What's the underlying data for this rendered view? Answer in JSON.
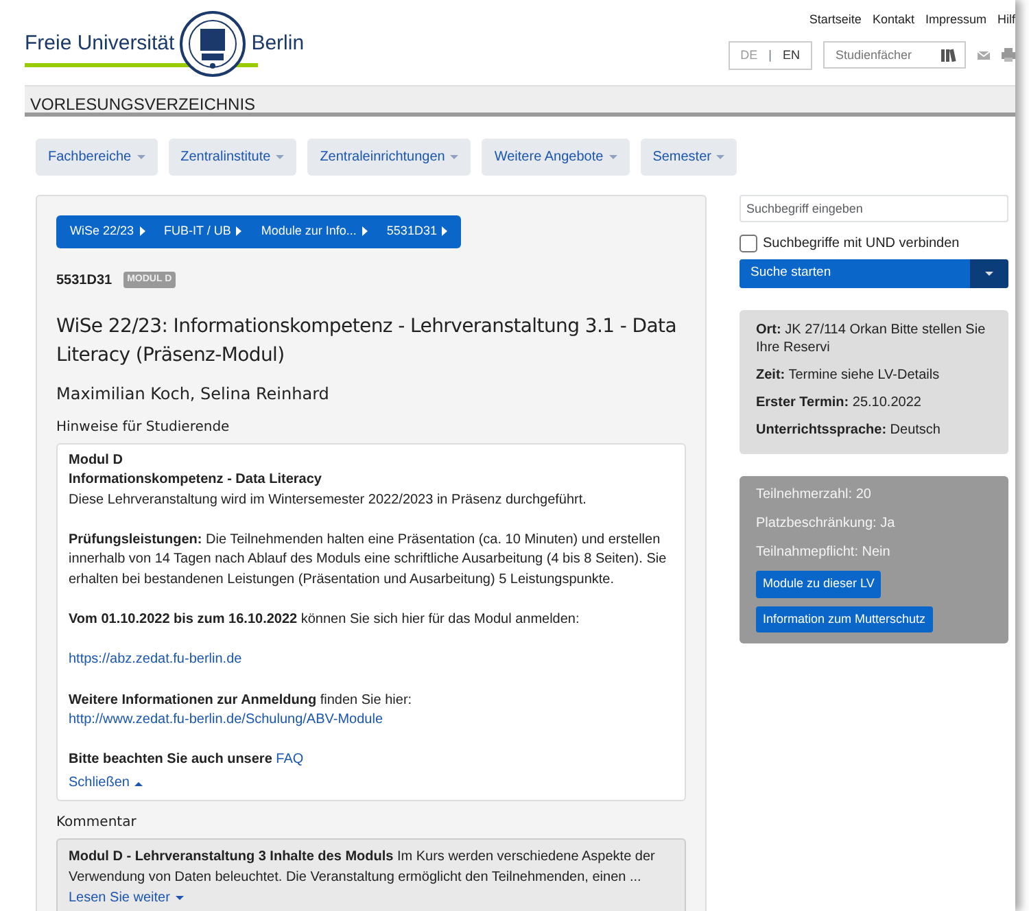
{
  "logo": {
    "left": "Freie Universität",
    "right": "Berlin"
  },
  "top_links": [
    "Startseite",
    "Kontakt",
    "Impressum",
    "Hilf"
  ],
  "language_separator": "|",
  "languages": [
    {
      "label": "DE",
      "selected": true
    },
    {
      "label": "EN",
      "selected": false
    }
  ],
  "subject_search": {
    "placeholder": "Studienfächer"
  },
  "section_title": "VORLESUNGSVERZEICHNIS",
  "nav": [
    "Fachbereiche",
    "Zentralinstitute",
    "Zentraleinrichtungen",
    "Weitere Angebote",
    "Semester"
  ],
  "breadcrumb": [
    "WiSe 22/23",
    "FUB-IT / UB",
    "Module zur Info...",
    "5531D31"
  ],
  "course": {
    "number": "5531D31",
    "badge": "MODUL D",
    "title": "WiSe 22/23: Informationskompetenz - Lehrveranstaltung 3.1 - Data Literacy (Präsenz-Modul)",
    "lecturers": "Maximilian Koch, Selina Reinhard"
  },
  "notes": {
    "heading": "Hinweise für Studierende",
    "paragraphs": [
      {
        "lines": [
          {
            "text": "**Modul D**"
          },
          {
            "text": "**Informationskompetenz - Data Literacy**"
          },
          {
            "text": "Diese Lehrveranstaltung wird im Wintersemester 2022/2023 in Präsenz durchgeführt."
          }
        ]
      },
      {
        "lines": [
          {
            "text": "**Prüfungsleistungen:** Die Teilnehmenden halten eine Präsentation (ca. 10 Minuten) und erstellen innerhalb von 14 Tagen nach Ablauf des Moduls eine schriftliche Ausarbeitung (4 bis 8 Seiten). Sie erhalten bei bestandenen Leistungen (Präsentation und Ausarbeitung) 5 Leistungspunkte."
          }
        ]
      },
      {
        "lines": [
          {
            "text": "**Vom 01.10.2022 bis zum 16.10.2022** können Sie sich hier für das Modul anmelden:"
          }
        ]
      },
      {
        "lines": [
          {
            "link": "https://abz.zedat.fu-berlin.de"
          }
        ]
      },
      {
        "lines": [
          {
            "text": "**Weitere Informationen zur Anmeldung** finden Sie hier:",
            "link": "http://www.zedat.fu-berlin.de/Schulung/ABV-Module"
          }
        ]
      },
      {
        "lines": [
          {
            "text": "**Bitte beachten Sie auch unsere**",
            "link": "FAQ"
          }
        ]
      }
    ],
    "toggle": {
      "label": "Schließen",
      "expanded": true
    }
  },
  "comment": {
    "heading": "Kommentar",
    "text": "**Modul D - Lehrveranstaltung 3 Inhalte des Moduls** Im Kurs werden verschiedene Aspekte der Verwendung von Daten beleuchtet. Die Veranstaltung ermöglicht den Teilnehmenden, einen ...",
    "toggle": {
      "label": "Lesen Sie weiter",
      "expanded": false
    }
  },
  "search": {
    "placeholder": "Suchbegriff eingeben",
    "and_option": {
      "label": "Suchbegriffe mit UND verbinden",
      "checked": false
    },
    "button": "Suche starten"
  },
  "details": [
    {
      "label": "Ort:",
      "value": "JK 27/114 Orkan Bitte stellen Sie Ihre Reservi"
    },
    {
      "label": "Zeit:",
      "value": "Termine siehe LV-Details"
    },
    {
      "label": "Erster Termin:",
      "value": "25.10.2022"
    },
    {
      "label": "Unterrichtssprache:",
      "value": "Deutsch"
    }
  ],
  "participation": {
    "lines": [
      "Teilnehmerzahl: 20",
      "Platzbeschränkung: Ja",
      "Teilnahmepflicht: Nein"
    ],
    "buttons": [
      "Module zu dieser LV",
      "Information zum Mutterschutz"
    ]
  }
}
